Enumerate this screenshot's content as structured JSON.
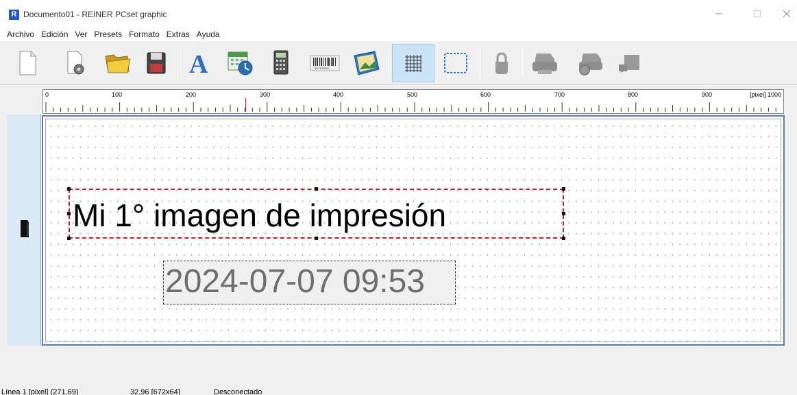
{
  "window": {
    "title": "Documento01 - REINER PCset graphic",
    "app_icon_letter": "R"
  },
  "menu": [
    "Archivo",
    "Edición",
    "Ver",
    "Presets",
    "Formato",
    "Extras",
    "Ayuda"
  ],
  "toolbar": {
    "tools": [
      {
        "icon": "new-document-icon"
      },
      {
        "icon": "document-settings-icon"
      },
      {
        "icon": "open-folder-icon"
      },
      {
        "icon": "save-icon"
      },
      {
        "icon": "text-tool-icon",
        "glyph": "A"
      },
      {
        "icon": "date-time-icon"
      },
      {
        "icon": "counter-calculator-icon"
      },
      {
        "icon": "barcode-icon",
        "caption": "ZKY000500"
      },
      {
        "icon": "image-import-icon"
      },
      {
        "icon": "grid-toggle-icon",
        "active": true
      },
      {
        "icon": "frame-select-icon"
      },
      {
        "icon": "lock-icon",
        "disabled": true
      },
      {
        "icon": "printer-icon",
        "disabled": true
      },
      {
        "icon": "print-preview-icon",
        "disabled": true
      },
      {
        "icon": "send-to-printer-icon",
        "disabled": true
      }
    ]
  },
  "ruler": {
    "labels": [
      "0",
      "100",
      "200",
      "300",
      "400",
      "500",
      "600",
      "700",
      "800",
      "900"
    ],
    "unit_label": "[pixel] 1000",
    "cursor_value": 271
  },
  "canvas": {
    "text_object": "Mi 1° imagen de impresión",
    "date_object": "2024-07-07 09:53"
  },
  "status": {
    "position": "Línea 1 [pixel] (271,69)",
    "size": "32,96 [672x64]",
    "connection": "Desconectado"
  },
  "colors": {
    "selection_border": "#c92222",
    "canvas_border": "#5a7fa8",
    "side_panel": "#dce9f6",
    "active_tool": "#cce4f7"
  }
}
